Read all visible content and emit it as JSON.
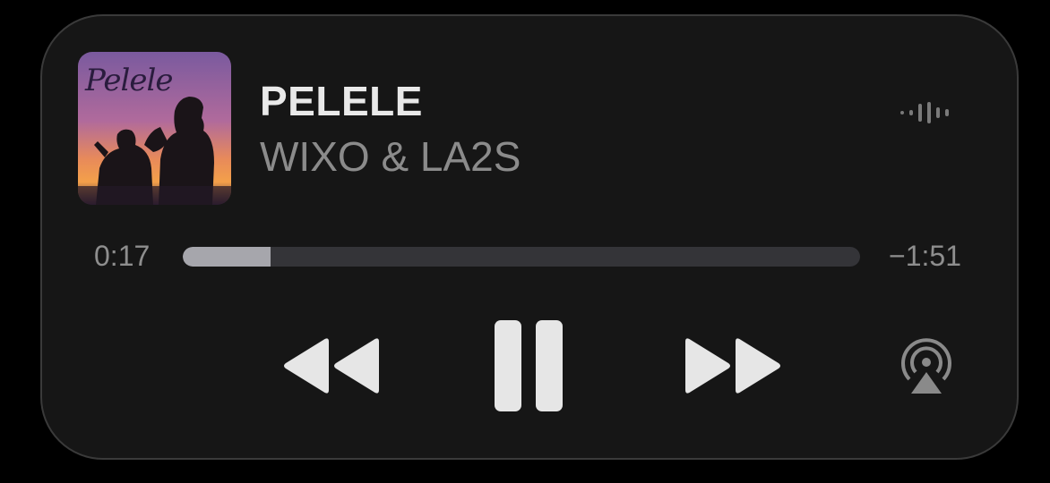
{
  "now_playing": {
    "title": "PELELE",
    "artist": "WIXO & LA2S",
    "artwork_text": "Pelele",
    "elapsed": "0:17",
    "remaining": "−1:51",
    "progress_fraction": 0.13
  },
  "controls": {
    "rewind_icon": "rewind-icon",
    "pause_icon": "pause-icon",
    "forward_icon": "fast-forward-icon",
    "airplay_icon": "airplay-icon",
    "waveform_icon": "audio-waveform-icon"
  },
  "colors": {
    "card_background": "#161616",
    "title": "#e9e9e9",
    "artist": "#8b8b8b",
    "progress_fill": "#a6a6ac",
    "progress_track": "#343438",
    "controls": "#e6e6e6"
  }
}
